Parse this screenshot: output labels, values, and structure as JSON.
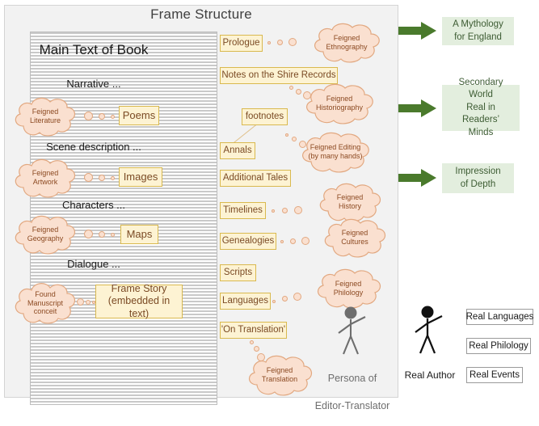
{
  "title": "Frame Structure",
  "main_text_block": {
    "heading": "Main Text of Book",
    "lines": [
      "Narrative ...",
      "Scene description ...",
      "Characters ...",
      "Dialogue ..."
    ]
  },
  "inline_boxes": [
    {
      "label": "Poems"
    },
    {
      "label": "Images"
    },
    {
      "label": "Maps"
    },
    {
      "label": "Frame Story\n(embedded in text)"
    }
  ],
  "left_clouds": [
    {
      "label": "Feigned\nLiterature"
    },
    {
      "label": "Feigned\nArtwork"
    },
    {
      "label": "Feigned\nGeography"
    },
    {
      "label": "Found\nManuscript\nconceit"
    }
  ],
  "paratext_boxes": [
    {
      "label": "Prologue"
    },
    {
      "label": "Notes on the Shire Records"
    },
    {
      "label": "footnotes"
    },
    {
      "label": "Annals"
    },
    {
      "label": "Additional Tales"
    },
    {
      "label": "Timelines"
    },
    {
      "label": "Genealogies"
    },
    {
      "label": "Scripts"
    },
    {
      "label": "Languages"
    },
    {
      "label": "'On Translation'"
    }
  ],
  "right_clouds": [
    {
      "label": "Feigned\nEthnography"
    },
    {
      "label": "Feigned\nHistoriography"
    },
    {
      "label": "Feigned Editing\n(by many hands)"
    },
    {
      "label": "Feigned\nHistory"
    },
    {
      "label": "Feigned\nCultures"
    },
    {
      "label": "Feigned\nPhilology"
    },
    {
      "label": "Feigned\nTranslation"
    }
  ],
  "persona": {
    "caption_line1": "Persona of",
    "caption_line2": "Editor-Translator",
    "icon": "stick-figure-icon"
  },
  "author": {
    "caption": "Real Author",
    "icon": "stick-figure-icon"
  },
  "real_world_boxes": [
    {
      "label": "Real Languages"
    },
    {
      "label": "Real Philology"
    },
    {
      "label": "Real Events"
    }
  ],
  "outcomes": [
    {
      "label": "A Mythology\nfor England"
    },
    {
      "label": "Secondary World\nReal in Readers’\nMinds"
    },
    {
      "label": "Impression\nof Depth"
    }
  ],
  "colors": {
    "panel_bg": "#f2f2f2",
    "yellow_fill": "#fdf3d3",
    "yellow_border": "#d9b94f",
    "yellow_text": "#7a4a24",
    "cloud_fill": "#fae0d0",
    "cloud_stroke": "#e2a880",
    "cloud_text": "#8c4a22",
    "green_fill": "#e3eede",
    "green_text": "#3d5c33",
    "arrow_green": "#4a7a2c",
    "stripe_gray": "#c9c9c9",
    "figure_gray": "#6e6e6e",
    "figure_black": "#111111"
  }
}
